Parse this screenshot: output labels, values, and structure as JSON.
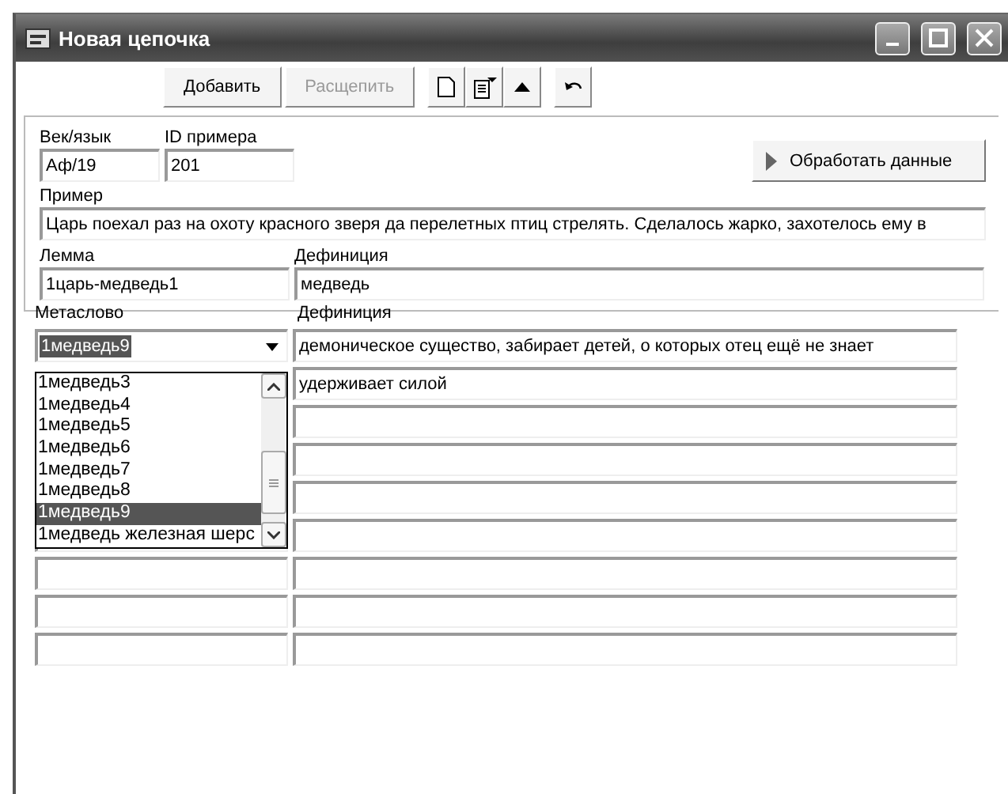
{
  "window": {
    "title": "Новая цепочка"
  },
  "toolbar": {
    "buttons": [
      {
        "label": "Добавить",
        "disabled": false
      },
      {
        "label": "Расщепить",
        "disabled": true
      }
    ]
  },
  "header": {
    "age_label": "Век/язык",
    "age_value": "Аф/19",
    "id_label": "ID примера",
    "id_value": "201",
    "process_button": "Обработать данные"
  },
  "example": {
    "label": "Пример",
    "value": "Царь поехал раз на охоту красного зверя да перелетных птиц стрелять. Сделалось жарко, захотелось ему в"
  },
  "lemma": {
    "label": "Лемма",
    "value": "1царь-медведь1",
    "definition_label": "Дефиниция",
    "definition": "медведь"
  },
  "metawords": {
    "label": "Метаслово",
    "definition_label": "Дефиниция",
    "combo_value": "1медведь9",
    "dropdown": [
      {
        "label": "1медведь3",
        "selected": false
      },
      {
        "label": "1медведь4",
        "selected": false
      },
      {
        "label": "1медведь5",
        "selected": false
      },
      {
        "label": "1медведь6",
        "selected": false
      },
      {
        "label": "1медведь7",
        "selected": false
      },
      {
        "label": "1медведь8",
        "selected": false
      },
      {
        "label": "1медведь9",
        "selected": true
      },
      {
        "label": "1медведь железная шерс",
        "selected": false
      }
    ],
    "definitions": [
      "демоническое существо, забирает детей, о которых отец ещё не знает",
      "удерживает силой"
    ]
  }
}
